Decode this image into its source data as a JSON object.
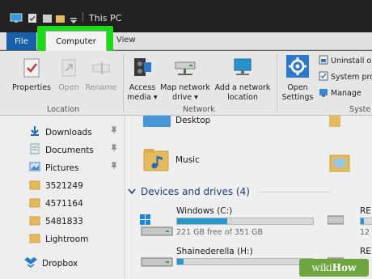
{
  "window": {
    "title": "This PC"
  },
  "tabs": {
    "file": "File",
    "computer": "Computer",
    "view": "View"
  },
  "ribbon": {
    "location": {
      "group_label": "Location",
      "properties": "Properties",
      "open": "Open",
      "rename": "Rename"
    },
    "network": {
      "group_label": "Network",
      "access_media_line1": "Access",
      "access_media_line2": "media",
      "map_drive_line1": "Map network",
      "map_drive_line2": "drive",
      "add_location_line1": "Add a network",
      "add_location_line2": "location"
    },
    "system": {
      "group_label": "Syste",
      "open_settings_line1": "Open",
      "open_settings_line2": "Settings",
      "uninstall": "Uninstall o",
      "system_properties": "System pro",
      "manage": "Manage"
    }
  },
  "nav": {
    "items": [
      {
        "label": "Downloads",
        "icon": "download-arrow-icon",
        "pinned": true
      },
      {
        "label": "Documents",
        "icon": "documents-icon",
        "pinned": true
      },
      {
        "label": "Pictures",
        "icon": "pictures-icon",
        "pinned": true
      },
      {
        "label": "3521249",
        "icon": "folder-icon",
        "pinned": false
      },
      {
        "label": "4571164",
        "icon": "folder-icon",
        "pinned": false
      },
      {
        "label": "5481833",
        "icon": "folder-icon",
        "pinned": false
      },
      {
        "label": "Lightroom",
        "icon": "folder-icon",
        "pinned": false
      },
      {
        "label": "Dropbox",
        "icon": "dropbox-icon",
        "pinned": false
      }
    ]
  },
  "main": {
    "folders": {
      "desktop": "Desktop",
      "music": "Music"
    },
    "devices_header": "Devices and drives (4)",
    "drives": [
      {
        "name": "Windows (C:)",
        "usage": "221 GB free of 351 GB",
        "used_fraction": 0.37
      },
      {
        "name": "Shainederella (H:)",
        "usage": "",
        "used_fraction": 0.05
      }
    ],
    "drives_right_partial": {
      "label1": "RE",
      "label2": "RE",
      "usage1": "12"
    }
  },
  "colors": {
    "file_tab": "#1b66b5",
    "highlight": "#1ee81b",
    "drive_fill": "#26a0da",
    "section_header": "#1e3f8a"
  },
  "watermark": {
    "prefix": "wiki",
    "suffix": "How"
  }
}
